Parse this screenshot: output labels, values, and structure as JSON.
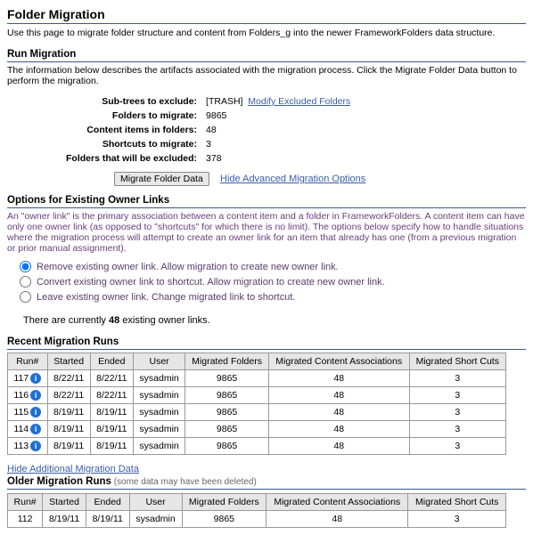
{
  "header": {
    "title": "Folder Migration",
    "desc": "Use this page to migrate folder structure and content from Folders_g into the newer FrameworkFolders data structure."
  },
  "run": {
    "title": "Run Migration",
    "desc": "The information below describes the artifacts associated with the migration process. Click the Migrate Folder Data button to perform the migration.",
    "rows": [
      {
        "label": "Sub-trees to exclude:",
        "value": "[TRASH]",
        "link": "Modify Excluded Folders"
      },
      {
        "label": "Folders to migrate:",
        "value": "9865"
      },
      {
        "label": "Content items in folders:",
        "value": "48"
      },
      {
        "label": "Shortcuts to migrate:",
        "value": "3"
      },
      {
        "label": "Folders that will be excluded:",
        "value": "378"
      }
    ],
    "button": "Migrate Folder Data",
    "hide_link": "Hide Advanced Migration Options"
  },
  "owner": {
    "title": "Options for Existing Owner Links",
    "desc": "An \"owner link\" is the primary association between a content item and a folder in FrameworkFolders. A content item can have only one owner link (as opposed to \"shortcuts\" for which there is no limit). The options below specify how to handle situations where the migration process will attempt to create an owner link for an item that already has one (from a previous migration or prior manual assignment).",
    "options": [
      "Remove existing owner link. Allow migration to create new owner link.",
      "Convert existing owner link to shortcut. Allow migration to create new owner link.",
      "Leave existing owner link. Change migrated link to shortcut."
    ],
    "count_prefix": "There are currently ",
    "count_bold": "48",
    "count_suffix": " existing owner links."
  },
  "recent": {
    "title": "Recent Migration Runs",
    "headers": [
      "Run#",
      "Started",
      "Ended",
      "User",
      "Migrated Folders",
      "Migrated Content Associations",
      "Migrated Short Cuts"
    ],
    "rows": [
      {
        "run": "117",
        "started": "8/22/11",
        "ended": "8/22/11",
        "user": "sysadmin",
        "folders": "9865",
        "assoc": "48",
        "shortcuts": "3"
      },
      {
        "run": "116",
        "started": "8/22/11",
        "ended": "8/22/11",
        "user": "sysadmin",
        "folders": "9865",
        "assoc": "48",
        "shortcuts": "3"
      },
      {
        "run": "115",
        "started": "8/19/11",
        "ended": "8/19/11",
        "user": "sysadmin",
        "folders": "9865",
        "assoc": "48",
        "shortcuts": "3"
      },
      {
        "run": "114",
        "started": "8/19/11",
        "ended": "8/19/11",
        "user": "sysadmin",
        "folders": "9865",
        "assoc": "48",
        "shortcuts": "3"
      },
      {
        "run": "113",
        "started": "8/19/11",
        "ended": "8/19/11",
        "user": "sysadmin",
        "folders": "9865",
        "assoc": "48",
        "shortcuts": "3"
      }
    ]
  },
  "older": {
    "hide_link": "Hide Additional Migration Data",
    "title": "Older Migration Runs",
    "note": " (some data may have been deleted)",
    "headers": [
      "Run#",
      "Started",
      "Ended",
      "User",
      "Migrated Folders",
      "Migrated Content Associations",
      "Migrated Short Cuts"
    ],
    "rows": [
      {
        "run": "112",
        "started": "8/19/11",
        "ended": "8/19/11",
        "user": "sysadmin",
        "folders": "9865",
        "assoc": "48",
        "shortcuts": "3"
      }
    ]
  }
}
